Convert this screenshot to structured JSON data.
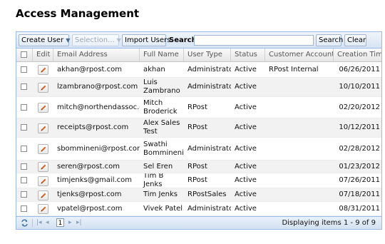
{
  "page": {
    "title": "Access Management"
  },
  "toolbar": {
    "create_user": "Create User",
    "selection": "Selection...",
    "import_users": "Import Users",
    "search_label": "Search:",
    "search_value": "",
    "search_button": "Search",
    "clear_button": "Clear"
  },
  "grid": {
    "headers": [
      "",
      "Edit",
      "Email Address",
      "Full Name",
      "User Type",
      "Status",
      "Customer Account",
      "Creation Time"
    ],
    "rows": [
      {
        "email": "akhan@rpost.com",
        "name": "akhan",
        "type": "Administrator",
        "status": "Active",
        "account": "RPost Internal",
        "created": "06/26/2011"
      },
      {
        "email": "lzambrano@rpost.com",
        "name": "Luis Zambrano",
        "type": "Administrator",
        "status": "Active",
        "account": "",
        "created": "10/10/2011"
      },
      {
        "email": "mitch@northendassoc.com",
        "name": "Mitch Broderick",
        "type": "RPost",
        "status": "Active",
        "account": "",
        "created": "02/20/2012"
      },
      {
        "email": "receipts@rpost.com",
        "name": "Alex Sales Test",
        "type": "RPost",
        "status": "Active",
        "account": "",
        "created": "10/12/2011"
      },
      {
        "email": "sbommineni@rpost.com",
        "name": "Swathi Bommineni",
        "type": "Administrator",
        "status": "Active",
        "account": "",
        "created": "02/28/2012"
      },
      {
        "email": "seren@rpost.com",
        "name": "Sel Eren",
        "type": "RPost",
        "status": "Active",
        "account": "",
        "created": "01/23/2012"
      },
      {
        "email": "timjenks@gmail.com",
        "name": "Tim B Jenks",
        "type": "RPost",
        "status": "Active",
        "account": "",
        "created": "07/26/2011"
      },
      {
        "email": "tjenks@rpost.com",
        "name": "Tim Jenks",
        "type": "RPostSales",
        "status": "Active",
        "account": "",
        "created": "07/18/2011"
      },
      {
        "email": "vpatel@rpost.com",
        "name": "Vivek Patel",
        "type": "Administrator",
        "status": "Active",
        "account": "",
        "created": "08/31/2011"
      }
    ]
  },
  "pager": {
    "current_page": "1",
    "summary": "Displaying items 1 - 9 of 9"
  },
  "icons": {
    "refresh": "refresh-icon",
    "first": "first-page-icon",
    "prev": "prev-page-icon",
    "next": "next-page-icon",
    "last": "last-page-icon",
    "edit": "pencil-icon"
  },
  "colors": {
    "panel_border": "#99bbe8",
    "row_alt": "#f2f2f2",
    "pencil": "#d9601f"
  }
}
